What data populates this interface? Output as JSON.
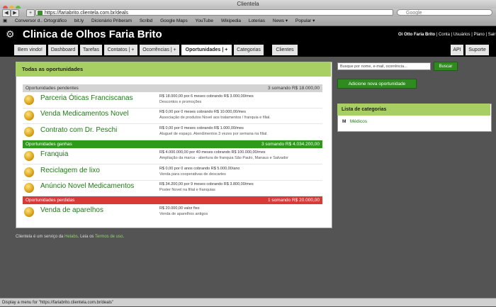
{
  "browser": {
    "window_title": "Clientela",
    "url": "https://fariabrito.clientela.com.br/deals",
    "search_placeholder": "Google",
    "bookmarks": [
      "Conversor d.. Ortográfico",
      "bit.ly",
      "Dicionário Priberam",
      "Scribd",
      "Google Maps",
      "YouTube",
      "Wikipedia",
      "Loterias",
      "News ▾",
      "Popular ▾"
    ],
    "status_text": "Display a menu for \"https://fariabrito.clientela.com.br/deals\""
  },
  "app": {
    "title": "Clinica de Olhos Faria Brito",
    "user_greeting": "Oi Otto Faria Brito",
    "links": [
      "Conta",
      "Usuários",
      "Plano",
      "Sair"
    ]
  },
  "tabs": [
    {
      "label": "Bem vindo!"
    },
    {
      "label": "Dashboard"
    },
    {
      "label": "Tarefas"
    },
    {
      "label": "Contatos | +"
    },
    {
      "label": "Ocorrências | +"
    },
    {
      "label": "Oportunidades | +"
    },
    {
      "label": "Categorias"
    },
    {
      "label": "Clientes"
    },
    {
      "label": "API"
    },
    {
      "label": "Suporte"
    }
  ],
  "panel": {
    "title": "Todas as oportunidades",
    "sections": [
      {
        "title": "Oportunidades pendentes",
        "summary": "3 somando R$ 18.000,00",
        "deals": [
          {
            "name": "Parceria Óticas Franciscanas",
            "value": "R$ 18.000,00 por 6 meses cobrando R$ 3.000,00/mes",
            "desc": "Descontos e promoções"
          },
          {
            "name": "Venda Medicamentos Novel",
            "value": "R$ 0,00 por 0 meses cobrando R$ 10.000,00/mes",
            "desc": "Associação de produtos Novel aos tratamentos / franquia e filial."
          },
          {
            "name": "Contrato com Dr. Peschi",
            "value": "R$ 0,00 por 0 meses cobrando R$ 1.000,00/mes",
            "desc": "Aluguel de espaço. Atendimentos 3 vezes por semana na filial."
          }
        ]
      },
      {
        "title": "Oportunidades ganhas",
        "summary": "3 somando R$ 4.034.200,00",
        "deals": [
          {
            "name": "Franquia",
            "value": "R$ 4.000.000,00 por 40 meses cobrando R$ 100.000,00/mes",
            "desc": "Ampliação da marca - abertura de franquia São Paulo, Manaus e Salvador"
          },
          {
            "name": "Reciclagem de lixo",
            "value": "R$ 0,00 por 0 anos cobrando R$ 5.000,00/ano",
            "desc": "Venda para cooperativas de descartes"
          },
          {
            "name": "Anúncio Novel Medicamentos",
            "value": "R$ 34.200,00 por 9 meses cobrando R$ 3.800,00/mes",
            "desc": "Poster Novel na filial e franquias"
          }
        ]
      },
      {
        "title": "Oportunidades perdidas",
        "summary": "1 somando R$ 20.000,00",
        "deals": [
          {
            "name": "Venda de aparelhos",
            "value": "R$ 20.000,00 valor fixo",
            "desc": "Venda de aparelhos antigos"
          }
        ]
      }
    ]
  },
  "sidebar": {
    "search_value": "Busque por nome, e-mail, ocorrência...",
    "search_button": "Buscar",
    "add_button": "Adicione nova oportunidade",
    "categories_title": "Lista de categorias",
    "category_badge": "M",
    "category_link": "Médicos"
  },
  "footer": {
    "text_start": "Clientela é um serviço da ",
    "company": "Helabs",
    "text_mid": ". Leia os ",
    "terms": "Termos de uso",
    "text_end": "."
  }
}
